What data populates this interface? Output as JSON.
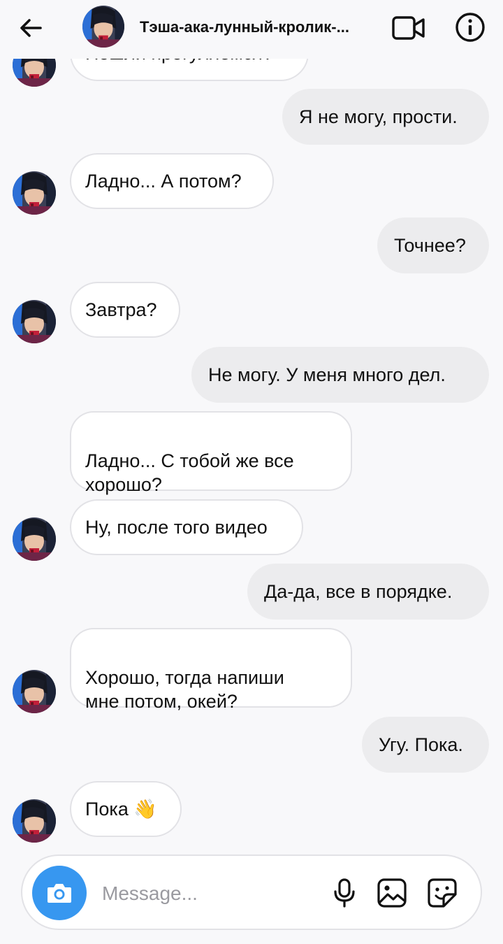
{
  "header": {
    "title": "Тэша-ака-лунный-кролик-...",
    "back_icon": "arrow-left-icon",
    "video_icon": "video-camera-icon",
    "info_icon": "info-icon"
  },
  "messages": [
    {
      "side": "in",
      "text": "Пошли прогуляемся?",
      "avatar": true
    },
    {
      "side": "out",
      "text": "Я не могу, прости."
    },
    {
      "side": "in",
      "text": "Ладно... А потом?",
      "avatar": true
    },
    {
      "side": "out",
      "text": "Точнее?"
    },
    {
      "side": "in",
      "text": "Завтра?",
      "avatar": true
    },
    {
      "side": "out",
      "text": "Не могу. У меня много дел."
    },
    {
      "side": "in",
      "text": "Ладно... С тобой же все\nхорошо?",
      "avatar": false
    },
    {
      "side": "in",
      "text": "Ну, после того видео",
      "avatar": true
    },
    {
      "side": "out",
      "text": "Да-да, все в порядке."
    },
    {
      "side": "in",
      "text": "Хорошо, тогда напиши\nмне потом, окей?",
      "avatar": true
    },
    {
      "side": "out",
      "text": "Угу. Пока."
    },
    {
      "side": "in",
      "text": "Пока 👋",
      "avatar": true
    }
  ],
  "composer": {
    "placeholder": "Message...",
    "camera_icon": "camera-icon",
    "mic_icon": "microphone-icon",
    "gallery_icon": "gallery-icon",
    "sticker_icon": "sticker-icon"
  },
  "colors": {
    "background": "#f8f8fa",
    "incoming_bubble": "#ffffff",
    "outgoing_bubble": "#ececee",
    "accent": "#3797f0"
  }
}
